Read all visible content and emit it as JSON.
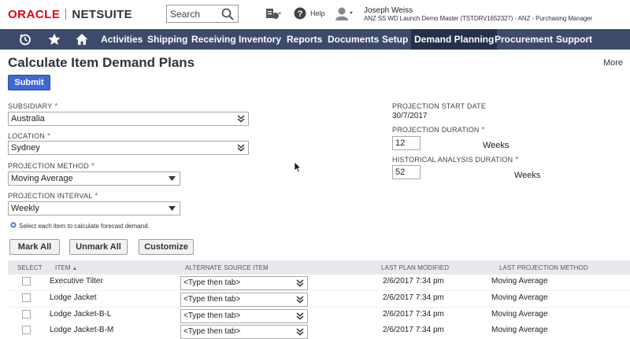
{
  "header": {
    "logo_oracle": "ORACLE",
    "logo_netsuite": "NETSUITE",
    "search_placeholder": "Search",
    "help_label": "Help",
    "user_name": "Joseph Weiss",
    "user_role": "ANZ SS WD Launch Demo Master (TSTDRV1652327) - ANZ - Purchasing Manager"
  },
  "nav": {
    "icons": [
      "recent-records-icon",
      "star-icon",
      "home-icon"
    ],
    "items": [
      {
        "label": "Activities",
        "active": false
      },
      {
        "label": "Shipping",
        "active": false
      },
      {
        "label": "Receiving",
        "active": false
      },
      {
        "label": "Inventory",
        "active": false
      },
      {
        "label": "Reports",
        "active": false
      },
      {
        "label": "Documents",
        "active": false
      },
      {
        "label": "Setup",
        "active": false
      },
      {
        "label": "Demand Planning",
        "active": true
      },
      {
        "label": "Procurement",
        "active": false
      },
      {
        "label": "Support",
        "active": false
      }
    ]
  },
  "page": {
    "title": "Calculate Item Demand Plans",
    "more_label": "More",
    "submit_label": "Submit"
  },
  "form": {
    "subsidiary": {
      "label": "Subsidiary",
      "value": "Australia"
    },
    "location": {
      "label": "Location",
      "value": "Sydney"
    },
    "projection_method": {
      "label": "Projection Method",
      "value": "Moving Average"
    },
    "projection_interval": {
      "label": "Projection Interval",
      "value": "Weekly"
    },
    "projection_start_date": {
      "label": "Projection Start Date",
      "value": "30/7/2017"
    },
    "projection_duration": {
      "label": "Projection Duration",
      "value": "12",
      "unit": "Weeks"
    },
    "historical_analysis_duration": {
      "label": "Historical Analysis Duration",
      "value": "52",
      "unit": "Weeks"
    },
    "required_mark": "*",
    "info_text": "Select each item to calculate forecast demand."
  },
  "list": {
    "buttons": {
      "mark_all": "Mark All",
      "unmark_all": "Unmark All",
      "customize": "Customize"
    },
    "columns": {
      "select": "Select",
      "item": "Item",
      "sort_indicator": "▲",
      "alternate_source_item": "Alternate Source Item",
      "last_plan_modified": "Last Plan Modified",
      "last_projection_method": "Last Projection Method"
    },
    "rows": [
      {
        "item": "Executive Tilter",
        "alt_source": "<Type then tab>",
        "last_plan_modified": "2/6/2017 7:34 pm",
        "last_projection_method": "Moving Average"
      },
      {
        "item": "Lodge Jacket",
        "alt_source": "<Type then tab>",
        "last_plan_modified": "2/6/2017 7:34 pm",
        "last_projection_method": "Moving Average"
      },
      {
        "item": "Lodge Jacket-B-L",
        "alt_source": "<Type then tab>",
        "last_plan_modified": "2/6/2017 7:34 pm",
        "last_projection_method": "Moving Average"
      },
      {
        "item": "Lodge Jacket-B-M",
        "alt_source": "<Type then tab>",
        "last_plan_modified": "2/6/2017 7:34 pm",
        "last_projection_method": "Moving Average"
      }
    ]
  },
  "colors": {
    "nav_bg": "#3d4a6b",
    "nav_active_bg": "#25304a",
    "submit_bg": "#3f6ad1",
    "logo_red": "#e2001a"
  }
}
